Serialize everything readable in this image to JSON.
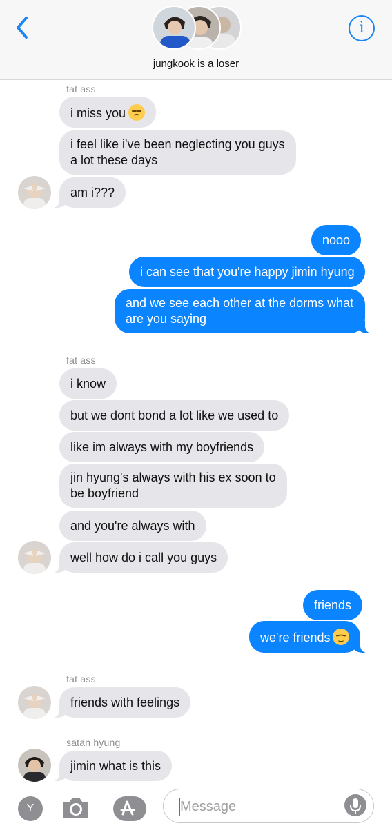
{
  "header": {
    "title": "jungkook is a loser",
    "back_icon": "chevron-left-icon",
    "info_icon": "info-icon",
    "info_label": "i",
    "accent": "#1a86f5"
  },
  "colors": {
    "incoming": "#e5e5ea",
    "outgoing": "#0b84ff"
  },
  "messages": {
    "s1": "fat ass",
    "m1": "i miss you",
    "m2a": "i feel like i've been neglecting you guys",
    "m2b": "a lot these days",
    "m3": "am i???",
    "o1": "nooo",
    "o2": "i can see that you're happy jimin hyung",
    "o3a": "and we see each other at the dorms what",
    "o3b": "are you saying",
    "s2": "fat ass",
    "m4": "i know",
    "m5": "but we dont bond a lot like we used to",
    "m6": "like im always with my boyfriends",
    "m7a": "jin hyung's always with his ex soon to",
    "m7b": "be boyfriend",
    "m8": "and you're always with",
    "m9": "well how do i call you guys",
    "o4": "friends",
    "o5": "we're friends",
    "s3": "fat ass",
    "m10": "friends with feelings",
    "s4": "satan hyung",
    "m11": "jimin what is this"
  },
  "toolbar": {
    "y_label": "Y",
    "camera_icon": "camera-icon",
    "appstore_icon": "app-store-icon",
    "mic_icon": "microphone-icon"
  },
  "input": {
    "placeholder": "Message",
    "value": ""
  }
}
